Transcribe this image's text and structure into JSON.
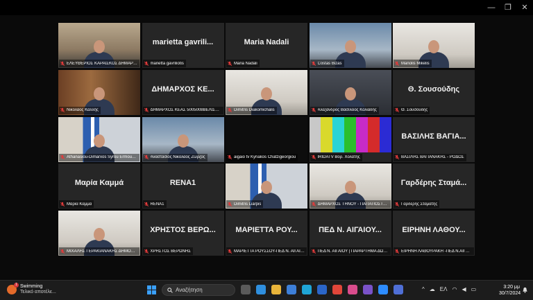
{
  "window": {
    "controls": {
      "minimize": "—",
      "restore": "❐",
      "close": "✕"
    }
  },
  "meeting": {
    "tiles": [
      {
        "kind": "video",
        "scene": "v-office",
        "tag": "ΕΛΕΥΘΕΡΙΟΣ ΚΑΡΑΙΣΚΟΣ ΔΗΜΑΡΧΟΣ..."
      },
      {
        "kind": "name",
        "name": "marietta gavrili...",
        "tag": "marietta gavriliotis"
      },
      {
        "kind": "name",
        "name": "Maria Nadali",
        "tag": "Maria Nadali"
      },
      {
        "kind": "video",
        "scene": "v-blue",
        "tag": "Costas Bizas"
      },
      {
        "kind": "video",
        "scene": "v-light",
        "tag": "Manolis Mikelis"
      },
      {
        "kind": "video",
        "scene": "v-wood",
        "tag": "Νικόλαος Καλλής",
        "active": true
      },
      {
        "kind": "name",
        "name": "ΔΗΜΑΡΧΟΣ ΚΕ...",
        "tag": "ΔΗΜΑΡΧΟΣ ΚΕΑΣ 5005008ΒΕΛΙΣΣΑΡΟ..."
      },
      {
        "kind": "video",
        "scene": "v-light",
        "tag": "Dimitris Diakomichalis"
      },
      {
        "kind": "video",
        "scene": "v-dark",
        "tag": "Αλέξανδρος Βασίλειος Κολιάδης"
      },
      {
        "kind": "name",
        "name": "Θ. Σουσούδης",
        "tag": "Θ. Σουσούδης"
      },
      {
        "kind": "video",
        "scene": "v-flag",
        "tag": "Athanasiou-Dimarxos Syrou Ermoup..."
      },
      {
        "kind": "video",
        "scene": "v-blue",
        "tag": "Αναστασιος Νικόλαος Ζώρζος"
      },
      {
        "kind": "video",
        "scene": "v-black",
        "tag": "aigaio tv Kyriakos Chatzigeorgiou"
      },
      {
        "kind": "bars",
        "tag": "IRIDATV Βορ. Χολάτης"
      },
      {
        "kind": "name",
        "name": "ΒΑΣΙΛΗΣ ΒΑΓΙΑ...",
        "tag": "ΒΑΣΙΛΗΣ ΒΑΓΙΑΝΑΚΗΣ - ΡΟΔΟΣ"
      },
      {
        "kind": "name",
        "name": "Μαρία Καμμά",
        "tag": "Μαρία Καμμά"
      },
      {
        "kind": "name",
        "name": "RENA1",
        "tag": "RENA1"
      },
      {
        "kind": "video",
        "scene": "v-flag",
        "tag": "Dimitris Liarpis"
      },
      {
        "kind": "video",
        "scene": "v-light",
        "tag": "ΔΗΜΑΡΧΟΣ ΤΗΝΟΥ - ΠΑΠΑΠΟΣΤΟΛΟΥ"
      },
      {
        "kind": "name",
        "name": "Γαρδέρης Σταμά...",
        "tag": "Γαρδέρης Σταμάτης"
      },
      {
        "kind": "video",
        "scene": "v-light",
        "tag": "ΜΙΧΑΛΗΣ ΓΕΡΑΚΙΑΝΑΚΗΣ ΔΗΜΟΣ Κ..."
      },
      {
        "kind": "name",
        "name": "ΧΡΗΣΤΟΣ ΒΕΡΩ...",
        "tag": "ΧΡΗΣΤΟΣ ΒΕΡΩΝΗΣ"
      },
      {
        "kind": "name",
        "name": "ΜΑΡΙΕΤΤΑ ΡΟΥ...",
        "tag": "ΜΑΡΙΕΤΤΑ ΡΟΥΣΣΟΥ-ΠΕΔ Ν. ΑΙΓΑΙΟΥ"
      },
      {
        "kind": "name",
        "name": "ΠΕΔ Ν. ΑΙΓΑΙΟΥ...",
        "tag": "ΠΕΔ Ν. ΑΙΓΑΙΟΥ | ΠΑΡΑΡΤΗΜΑ ΔΩΔ..."
      },
      {
        "kind": "name",
        "name": "ΕΙΡΗΝΗ ΛΑΘΟΥ...",
        "tag": "ΕΙΡΗΝΗ ΛΑΘΟΥΡΑΚΗ -ΠΕΔ Ν.ΑΙΓΑΙΟ..."
      }
    ],
    "test_bar_colors": [
      "#c8c8c8",
      "#d9d92b",
      "#2ad4d4",
      "#2bbf2b",
      "#c72bc7",
      "#d42b2b",
      "#2b2bd4"
    ]
  },
  "taskbar": {
    "weather": {
      "title": "Swimming",
      "subtitle": "Τελικό αποτέλε...",
      "badge": "1"
    },
    "search_placeholder": "Αναζήτηση",
    "app_icons": [
      {
        "name": "task-view-icon",
        "color": "#5a5a5a"
      },
      {
        "name": "widgets-icon",
        "color": "#2f8fde"
      },
      {
        "name": "file-explorer-icon",
        "color": "#e8b43a"
      },
      {
        "name": "store-icon",
        "color": "#3d7fd8"
      },
      {
        "name": "edge-icon",
        "color": "#1fa5d6"
      },
      {
        "name": "mail-icon",
        "color": "#2b66c9"
      },
      {
        "name": "chrome-icon",
        "color": "#e0463a"
      },
      {
        "name": "photos-icon",
        "color": "#d94c8c"
      },
      {
        "name": "viber-icon",
        "color": "#7a52c8"
      },
      {
        "name": "zoom-icon",
        "color": "#2d8cff"
      },
      {
        "name": "app-icon",
        "color": "#4f6fd6"
      }
    ],
    "tray": {
      "chevron": "^",
      "language": "ΕΛ"
    },
    "clock": {
      "time": "3:20 μμ",
      "date": "30/7/2024"
    }
  }
}
